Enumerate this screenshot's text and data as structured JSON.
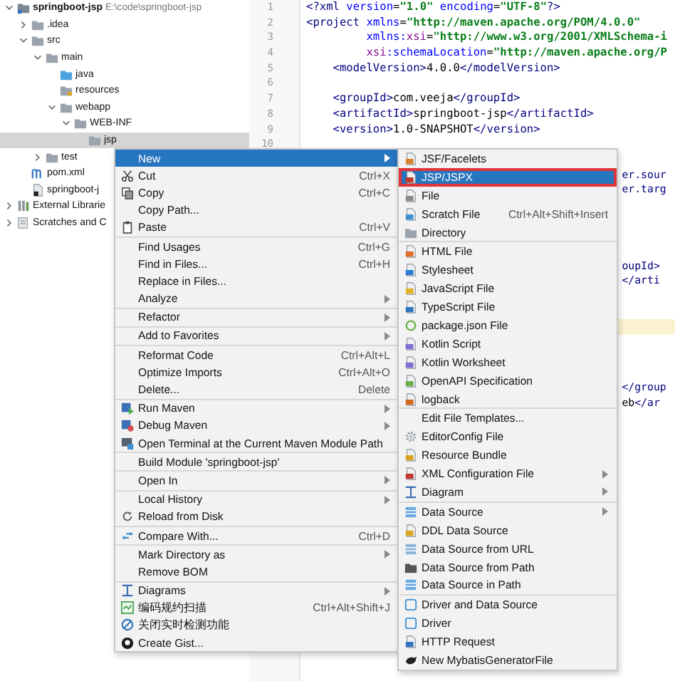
{
  "project_tree": {
    "items": [
      {
        "label": "springboot-jsp",
        "path": "E:\\code\\springboot-jsp",
        "kind": "module",
        "expanded": true,
        "selected": false,
        "children": [
          {
            "label": ".idea",
            "kind": "folder",
            "expanded": false,
            "selected": false
          },
          {
            "label": "src",
            "kind": "folder",
            "expanded": true,
            "selected": false,
            "children": [
              {
                "label": "main",
                "kind": "folder",
                "expanded": true,
                "selected": false,
                "children": [
                  {
                    "label": "java",
                    "kind": "source",
                    "selected": false
                  },
                  {
                    "label": "resources",
                    "kind": "resources",
                    "selected": false
                  },
                  {
                    "label": "webapp",
                    "kind": "folder",
                    "expanded": true,
                    "selected": false,
                    "children": [
                      {
                        "label": "WEB-INF",
                        "kind": "folder",
                        "expanded": true,
                        "selected": false,
                        "children": [
                          {
                            "label": "jsp",
                            "kind": "folder",
                            "selected": true
                          }
                        ]
                      }
                    ]
                  }
                ]
              },
              {
                "label": "test",
                "kind": "folder",
                "expanded": false,
                "selected": false
              }
            ]
          },
          {
            "label": "pom.xml",
            "kind": "maven",
            "selected": false
          },
          {
            "label": "springboot-j",
            "kind": "iml",
            "selected": false
          }
        ]
      },
      {
        "label": "External Librarie",
        "kind": "library",
        "expanded": false,
        "selected": false
      },
      {
        "label": "Scratches and C",
        "kind": "scratch",
        "expanded": false,
        "selected": false
      }
    ]
  },
  "editor": {
    "lines": [
      {
        "number": "1",
        "current": false,
        "segments": [
          {
            "kind": "tag",
            "text": "<?xml "
          },
          {
            "kind": "attr",
            "text": "version"
          },
          {
            "kind": "plain",
            "text": "="
          },
          {
            "kind": "string",
            "text": "\"1.0\""
          },
          {
            "kind": "attr",
            "text": " encoding"
          },
          {
            "kind": "plain",
            "text": "="
          },
          {
            "kind": "string",
            "text": "\"UTF-8\""
          },
          {
            "kind": "tag",
            "text": "?>"
          }
        ]
      },
      {
        "number": "2",
        "current": false,
        "segments": [
          {
            "kind": "tag",
            "text": "<project "
          },
          {
            "kind": "attr",
            "text": "xmlns"
          },
          {
            "kind": "plain",
            "text": "="
          },
          {
            "kind": "string",
            "text": "\"http://maven.apache.org/POM/4.0.0\""
          }
        ]
      },
      {
        "number": "3",
        "current": false,
        "kind": "attribute",
        "segments": [
          {
            "kind": "attr",
            "text": "xmlns:"
          },
          {
            "kind": "ns",
            "text": "xsi"
          },
          {
            "kind": "plain",
            "text": "="
          },
          {
            "kind": "string",
            "text": "\"http://www.w3.org/2001/XMLSchema-i"
          }
        ]
      },
      {
        "number": "4",
        "current": false,
        "kind": "attribute",
        "segments": [
          {
            "kind": "ns",
            "text": "xsi"
          },
          {
            "kind": "attr",
            "text": ":schemaLocation"
          },
          {
            "kind": "plain",
            "text": "="
          },
          {
            "kind": "string",
            "text": "\"http://maven.apache.org/P"
          }
        ]
      },
      {
        "number": "5",
        "current": false,
        "kind": "child",
        "segments": [
          {
            "kind": "tag",
            "text": "<modelVersion>"
          },
          {
            "kind": "plain",
            "text": "4.0.0"
          },
          {
            "kind": "tag",
            "text": "</modelVersion>"
          }
        ]
      },
      {
        "number": "6",
        "current": false
      },
      {
        "number": "7",
        "current": false,
        "kind": "child",
        "segments": [
          {
            "kind": "tag",
            "text": "<groupId>"
          },
          {
            "kind": "plain",
            "text": "com.veeja"
          },
          {
            "kind": "tag",
            "text": "</groupId>"
          }
        ]
      },
      {
        "number": "8",
        "current": false,
        "kind": "child",
        "segments": [
          {
            "kind": "tag",
            "text": "<artifactId>"
          },
          {
            "kind": "plain",
            "text": "springboot-jsp"
          },
          {
            "kind": "tag",
            "text": "</artifactId>"
          }
        ]
      },
      {
        "number": "9",
        "current": false,
        "kind": "child",
        "segments": [
          {
            "kind": "tag",
            "text": "<version>"
          },
          {
            "kind": "plain",
            "text": "1.0-SNAPSHOT"
          },
          {
            "kind": "tag",
            "text": "</version>"
          }
        ]
      },
      {
        "number": "10",
        "current": false
      },
      {
        "current": false
      },
      {
        "current": false,
        "tail": [
          {
            "kind": "tag",
            "text": "er.sour"
          }
        ]
      },
      {
        "current": false,
        "tail": [
          {
            "kind": "tag",
            "text": "er.targ"
          }
        ]
      },
      {
        "current": false
      },
      {
        "current": false
      },
      {
        "current": false
      },
      {
        "current": false
      },
      {
        "current": false,
        "tail": [
          {
            "kind": "tag",
            "text": "oupId>"
          }
        ]
      },
      {
        "current": false,
        "tail": [
          {
            "kind": "tag",
            "text": "</arti"
          }
        ]
      },
      {
        "current": false
      },
      {
        "current": false
      },
      {
        "current": true
      },
      {
        "current": false
      },
      {
        "current": false
      },
      {
        "current": false
      },
      {
        "current": false,
        "tail": [
          {
            "kind": "tag",
            "text": "</group"
          }
        ]
      },
      {
        "current": false,
        "tail": [
          {
            "kind": "plain",
            "text": "eb"
          },
          {
            "kind": "tag",
            "text": "</ar"
          }
        ]
      }
    ]
  },
  "context_menu": {
    "groups": [
      [
        {
          "label": "New",
          "submenu": true,
          "selected": true
        },
        {
          "label": "Cut",
          "shortcut": "Ctrl+X",
          "selected": false
        },
        {
          "label": "Copy",
          "shortcut": "Ctrl+C",
          "selected": false
        },
        {
          "label": "Copy Path...",
          "selected": false
        },
        {
          "label": "Paste",
          "shortcut": "Ctrl+V",
          "selected": false
        }
      ],
      [
        {
          "label": "Find Usages",
          "shortcut": "Ctrl+G",
          "selected": false
        },
        {
          "label": "Find in Files...",
          "shortcut": "Ctrl+H",
          "selected": false
        },
        {
          "label": "Replace in Files...",
          "selected": false
        },
        {
          "label": "Analyze",
          "submenu": true,
          "selected": false
        }
      ],
      [
        {
          "label": "Refactor",
          "submenu": true,
          "selected": false
        }
      ],
      [
        {
          "label": "Add to Favorites",
          "submenu": true,
          "selected": false
        }
      ],
      [
        {
          "label": "Reformat Code",
          "shortcut": "Ctrl+Alt+L",
          "selected": false
        },
        {
          "label": "Optimize Imports",
          "shortcut": "Ctrl+Alt+O",
          "selected": false
        },
        {
          "label": "Delete...",
          "shortcut": "Delete",
          "selected": false
        }
      ],
      [
        {
          "label": "Run Maven",
          "submenu": true,
          "selected": false
        },
        {
          "label": "Debug Maven",
          "submenu": true,
          "selected": false
        },
        {
          "label": "Open Terminal at the Current Maven Module Path",
          "selected": false
        }
      ],
      [
        {
          "label": "Build Module 'springboot-jsp'",
          "selected": false
        }
      ],
      [
        {
          "label": "Open In",
          "submenu": true,
          "selected": false
        }
      ],
      [
        {
          "label": "Local History",
          "submenu": true,
          "selected": false
        },
        {
          "label": "Reload from Disk",
          "selected": false
        }
      ],
      [
        {
          "label": "Compare With...",
          "shortcut": "Ctrl+D",
          "selected": false
        }
      ],
      [
        {
          "label": "Mark Directory as",
          "submenu": true,
          "selected": false
        },
        {
          "label": "Remove BOM",
          "selected": false
        }
      ],
      [
        {
          "label": "Diagrams",
          "submenu": true,
          "selected": false
        },
        {
          "label": "编码规约扫描",
          "shortcut": "Ctrl+Alt+Shift+J",
          "selected": false
        },
        {
          "label": "关闭实时检测功能",
          "selected": false
        },
        {
          "label": "Create Gist...",
          "selected": false
        }
      ]
    ]
  },
  "new_submenu": {
    "groups": [
      [
        {
          "label": "JSF/Facelets",
          "selected": false
        },
        {
          "label": "JSP/JSPX",
          "selected": true
        },
        {
          "label": "File",
          "selected": false
        },
        {
          "label": "Scratch File",
          "shortcut": "Ctrl+Alt+Shift+Insert",
          "selected": false
        },
        {
          "label": "Directory",
          "selected": false
        }
      ],
      [
        {
          "label": "HTML File",
          "selected": false
        },
        {
          "label": "Stylesheet",
          "selected": false
        },
        {
          "label": "JavaScript File",
          "selected": false
        },
        {
          "label": "TypeScript File",
          "selected": false
        },
        {
          "label": "package.json File",
          "selected": false
        },
        {
          "label": "Kotlin Script",
          "selected": false
        },
        {
          "label": "Kotlin Worksheet",
          "selected": false
        },
        {
          "label": "OpenAPI Specification",
          "selected": false
        },
        {
          "label": "logback",
          "selected": false
        }
      ],
      [
        {
          "label": "Edit File Templates...",
          "selected": false
        },
        {
          "label": "EditorConfig File",
          "selected": false
        },
        {
          "label": "Resource Bundle",
          "selected": false
        },
        {
          "label": "XML Configuration File",
          "submenu": true,
          "selected": false
        },
        {
          "label": "Diagram",
          "submenu": true,
          "selected": false
        }
      ],
      [
        {
          "label": "Data Source",
          "submenu": true,
          "selected": false
        },
        {
          "label": "DDL Data Source",
          "selected": false
        },
        {
          "label": "Data Source from URL",
          "selected": false
        },
        {
          "label": "Data Source from Path",
          "selected": false
        },
        {
          "label": "Data Source in Path",
          "selected": false
        }
      ],
      [
        {
          "label": "Driver and Data Source",
          "selected": false
        },
        {
          "label": "Driver",
          "selected": false
        },
        {
          "label": "HTTP Request",
          "selected": false
        },
        {
          "label": "New MybatisGeneratorFile",
          "selected": false
        }
      ]
    ]
  }
}
